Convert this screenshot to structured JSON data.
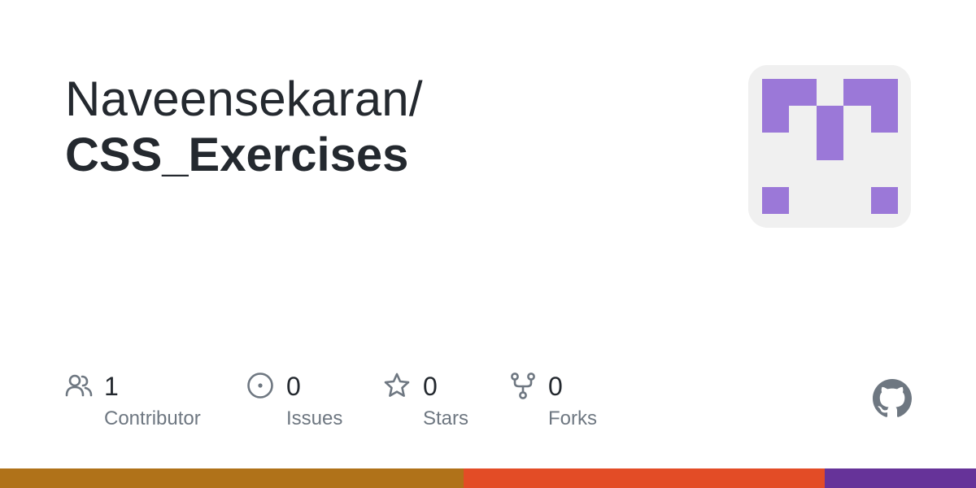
{
  "repo": {
    "owner": "Naveensekaran/",
    "name": "CSS_Exercises"
  },
  "avatar": {
    "background": "#f0f0f0",
    "color": "#9b78d8"
  },
  "stats": [
    {
      "icon": "people-icon",
      "value": "1",
      "label": "Contributor"
    },
    {
      "icon": "issue-opened-icon",
      "value": "0",
      "label": "Issues"
    },
    {
      "icon": "star-icon",
      "value": "0",
      "label": "Stars"
    },
    {
      "icon": "repo-forked-icon",
      "value": "0",
      "label": "Forks"
    }
  ],
  "brand_icon": "github-mark-icon",
  "language_bar": [
    {
      "color": "#b07219",
      "share": 0.475
    },
    {
      "color": "#e34c26",
      "share": 0.37
    },
    {
      "color": "#663399",
      "share": 0.155
    }
  ]
}
